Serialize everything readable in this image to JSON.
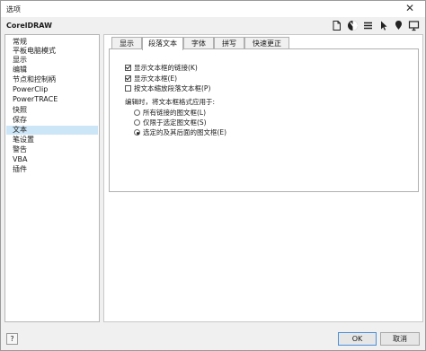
{
  "window": {
    "title": "选项",
    "close_glyph": "✕"
  },
  "header": {
    "app_name": "CorelDRAW",
    "toolbar_icons": [
      "document-icon",
      "color-icon",
      "menu-lines-icon",
      "cursor-icon",
      "balloon-icon",
      "monitor-icon"
    ]
  },
  "sidebar": {
    "items": [
      {
        "label": "常规",
        "selected": false
      },
      {
        "label": "平板电脑模式",
        "selected": false
      },
      {
        "label": "显示",
        "selected": false
      },
      {
        "label": "编辑",
        "selected": false
      },
      {
        "label": "节点和控制柄",
        "selected": false
      },
      {
        "label": "PowerClip",
        "selected": false
      },
      {
        "label": "PowerTRACE",
        "selected": false
      },
      {
        "label": "快照",
        "selected": false
      },
      {
        "label": "保存",
        "selected": false
      },
      {
        "label": "文本",
        "selected": true
      },
      {
        "label": "笔设置",
        "selected": false
      },
      {
        "label": "警告",
        "selected": false
      },
      {
        "label": "VBA",
        "selected": false
      },
      {
        "label": "插件",
        "selected": false
      }
    ]
  },
  "tabs": [
    {
      "label": "显示",
      "active": false
    },
    {
      "label": "段落文本",
      "active": true
    },
    {
      "label": "字体",
      "active": false
    },
    {
      "label": "拼写",
      "active": false
    },
    {
      "label": "快速更正",
      "active": false
    }
  ],
  "paragraph": {
    "checkboxes": [
      {
        "label": "显示文本框的链接(K)",
        "checked": true
      },
      {
        "label": "显示文本框(E)",
        "checked": true
      },
      {
        "label": "按文本缩放段落文本框(P)",
        "checked": false
      }
    ],
    "apply_heading": "编辑时，将文本框格式应用于:",
    "radios": [
      {
        "label": "所有链接的图文框(L)",
        "checked": false
      },
      {
        "label": "仅限于选定图文框(S)",
        "checked": false
      },
      {
        "label": "选定的及其后面的图文框(E)",
        "checked": true
      }
    ]
  },
  "footer": {
    "help": "?",
    "ok": "OK",
    "cancel": "取消"
  }
}
